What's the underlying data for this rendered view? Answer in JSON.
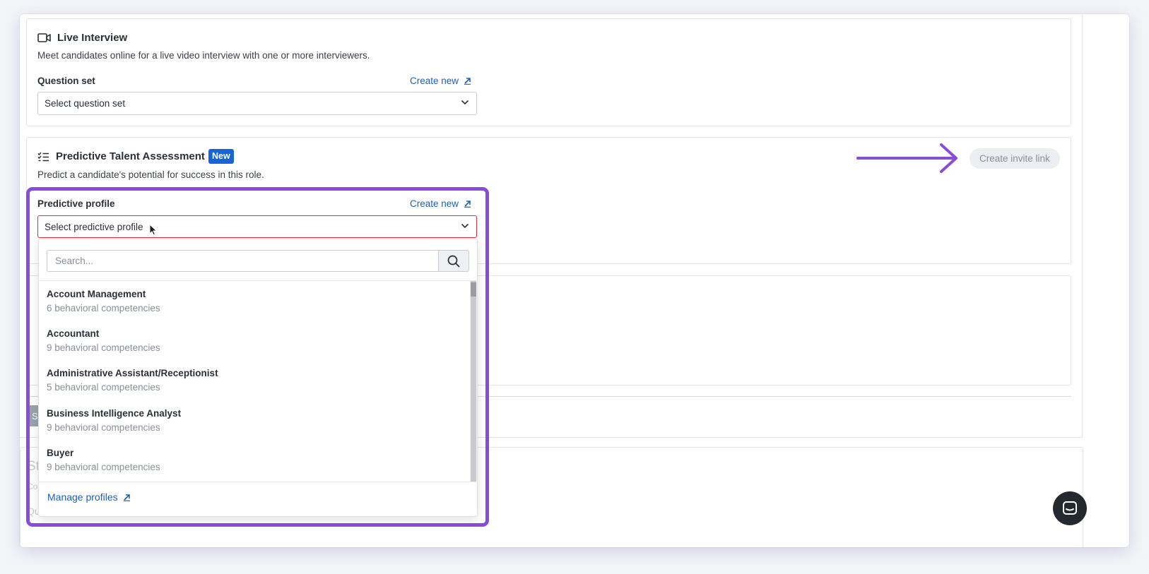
{
  "live_interview": {
    "title": "Live Interview",
    "description": "Meet candidates online for a live video interview with one or more interviewers.",
    "question_set_label": "Question set",
    "create_new_label": "Create new",
    "select_placeholder": "Select question set"
  },
  "predictive": {
    "title": "Predictive Talent Assessment",
    "badge": "New",
    "description": "Predict a candidate's potential for success in this role.",
    "create_invite_label": "Create invite link",
    "profile_label": "Predictive profile",
    "create_new_label": "Create new",
    "select_placeholder": "Select predictive profile"
  },
  "dropdown": {
    "search_placeholder": "Search...",
    "items": [
      {
        "title": "Account Management",
        "subtitle": "6 behavioral competencies"
      },
      {
        "title": "Accountant",
        "subtitle": "9 behavioral competencies"
      },
      {
        "title": "Administrative Assistant/Receptionist",
        "subtitle": "5 behavioral competencies"
      },
      {
        "title": "Business Intelligence Analyst",
        "subtitle": "9 behavioral competencies"
      },
      {
        "title": "Buyer",
        "subtitle": "9 behavioral competencies"
      }
    ],
    "manage_label": "Manage profiles"
  },
  "background": {
    "partial_button_letter": "S",
    "partial_title_letters": "St",
    "partial_desc_letters": "Co",
    "partial_label_letters": "Qu"
  },
  "colors": {
    "accent_purple": "#8a4bd8",
    "link_blue": "#1f5fb0",
    "badge_blue": "#1764d6",
    "error_red": "#d7323c"
  },
  "icons": [
    "video-camera-icon",
    "checklist-icon",
    "external-link-icon",
    "chevron-down-icon",
    "search-icon",
    "arrow-right-icon",
    "cursor-icon",
    "chat-icon"
  ]
}
